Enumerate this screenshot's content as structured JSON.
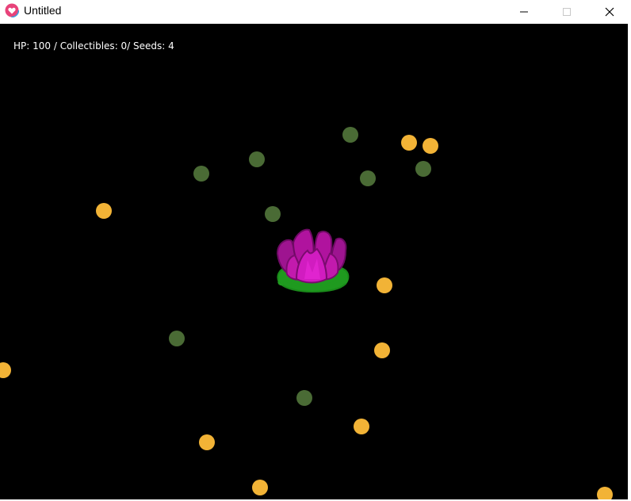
{
  "window": {
    "title": "Untitled",
    "app_icon": "heart-app-icon",
    "controls": [
      "minimize-icon",
      "maximize-icon",
      "close-icon"
    ]
  },
  "hud": {
    "text": "HP: 100 / Collectibles: 0/ Seeds: 4"
  },
  "colors": {
    "background": "#000000",
    "seed": "#4a6b35",
    "collectible": "#f2b336",
    "flower_petal": "#b0139e",
    "flower_leaf": "#1f9a1f"
  },
  "entities": {
    "player": "lotus-flower",
    "seed_orbs": 9,
    "collectible_orbs": 12
  }
}
